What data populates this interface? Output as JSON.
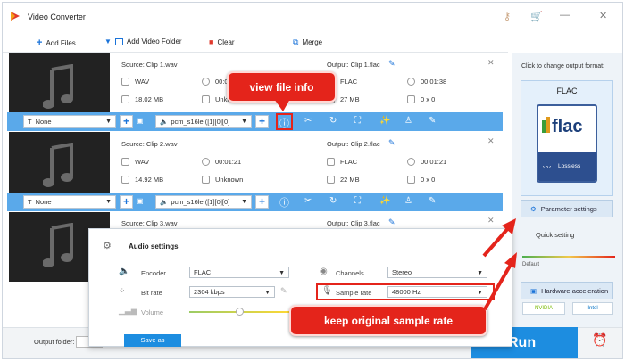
{
  "app": {
    "title": "Video Converter"
  },
  "toolbar": {
    "add_files": "Add Files",
    "add_video_folder": "Add Video Folder",
    "clear": "Clear",
    "merge": "Merge"
  },
  "clips": [
    {
      "source": "Source: Clip 1.wav",
      "src_format": "WAV",
      "src_duration": "00:0",
      "src_size": "18.02 MB",
      "src_res": "Unkn",
      "output": "Output: Clip 1.flac",
      "out_format": "FLAC",
      "out_duration": "00:01:38",
      "out_size": "27 MB",
      "out_res": "0 x 0"
    },
    {
      "source": "Source: Clip 2.wav",
      "src_format": "WAV",
      "src_duration": "00:01:21",
      "src_size": "14.92 MB",
      "src_res": "Unknown",
      "output": "Output: Clip 2.flac",
      "out_format": "FLAC",
      "out_duration": "00:01:21",
      "out_size": "22 MB",
      "out_res": "0 x 0"
    },
    {
      "source": "Source: Clip 3.wav",
      "output": "Output: Clip 3.flac"
    }
  ],
  "band": {
    "subtitle": "None",
    "audio_track": "pcm_s16le ([1][0][0]"
  },
  "side": {
    "click_to_change": "Click to change output format:",
    "format_name": "FLAC",
    "flac_logo": "flac",
    "lossless": "Lossless",
    "parameter_settings": "Parameter settings",
    "quick_setting": "Quick setting",
    "default_label": "Default",
    "hw_accel": "Hardware acceleration",
    "nvidia": "NVIDIA",
    "intel": "Intel"
  },
  "dialog": {
    "title": "Audio settings",
    "encoder_label": "Encoder",
    "encoder_value": "FLAC",
    "bitrate_label": "Bit rate",
    "bitrate_value": "2304 kbps",
    "volume_label": "Volume",
    "channels_label": "Channels",
    "channels_value": "Stereo",
    "samplerate_label": "Sample rate",
    "samplerate_value": "48000 Hz",
    "save_as": "Save as"
  },
  "callouts": {
    "view_info": "view file info",
    "keep_rate": "keep original sample rate"
  },
  "bottom": {
    "output_folder": "Output folder:",
    "run": "Run"
  },
  "colors": {
    "accent": "#1d8de0",
    "band": "#5aa9ea",
    "callout": "#e4241b"
  }
}
